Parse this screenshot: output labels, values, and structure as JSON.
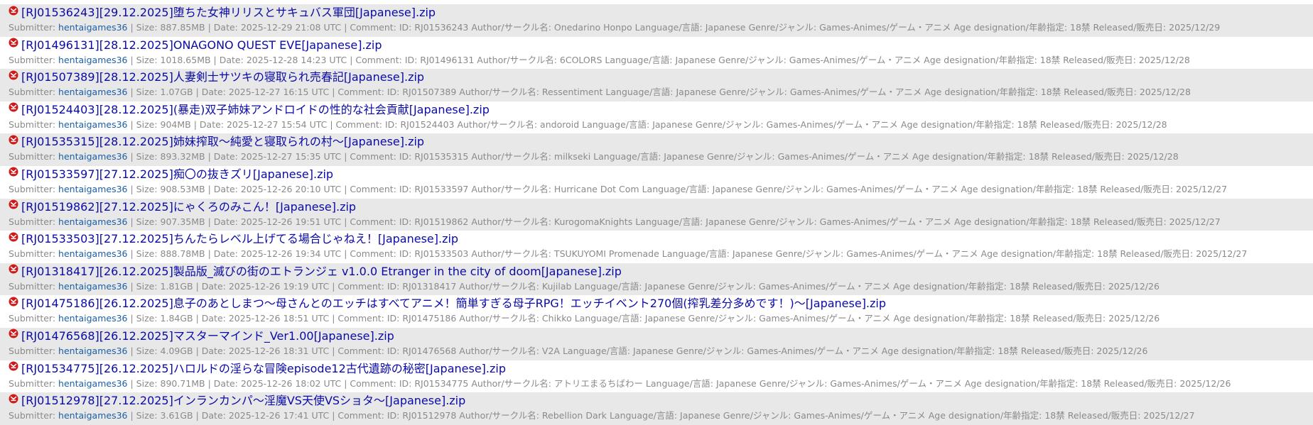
{
  "labels": {
    "submitter": "Submitter: ",
    "size": " | Size: ",
    "date": " | Date: ",
    "comment": " | Comment: "
  },
  "icon_name": "file-badge-icon",
  "items": [
    {
      "title": "[RJ01536243][29.12.2025]堕ちた女神リリスとサキュバス軍団[Japanese].zip",
      "submitter": "hentaigames36",
      "size": "887.85MB",
      "date": "2025-12-29 21:08 UTC",
      "comment": "ID: RJ01536243 Author/サークル名: Onedarino Honpo Language/言語: Japanese Genre/ジャンル: Games-Animes/ゲーム・アニメ Age designation/年齢指定: 18禁 Released/販売日: 2025/12/29"
    },
    {
      "title": "[RJ01496131][28.12.2025]ONAGONO QUEST EVE[Japanese].zip",
      "submitter": "hentaigames36",
      "size": "1018.65MB",
      "date": "2025-12-28 14:23 UTC",
      "comment": "ID: RJ01496131 Author/サークル名: 6COLORS Language/言語: Japanese Genre/ジャンル: Games-Animes/ゲーム・アニメ Age designation/年齢指定: 18禁 Released/販売日: 2025/12/28"
    },
    {
      "title": "[RJ01507389][28.12.2025]人妻剣士サツキの寝取られ売春記[Japanese].zip",
      "submitter": "hentaigames36",
      "size": "1.07GB",
      "date": "2025-12-27 16:15 UTC",
      "comment": "ID: RJ01507389 Author/サークル名: Ressentiment Language/言語: Japanese Genre/ジャンル: Games-Animes/ゲーム・アニメ Age designation/年齢指定: 18禁 Released/販売日: 2025/12/28"
    },
    {
      "title": "[RJ01524403][28.12.2025](暴走)双子姉妹アンドロイドの性的な社会貢献[Japanese].zip",
      "submitter": "hentaigames36",
      "size": "904MB",
      "date": "2025-12-27 15:54 UTC",
      "comment": "ID: RJ01524403 Author/サークル名: andoroid Language/言語: Japanese Genre/ジャンル: Games-Animes/ゲーム・アニメ Age designation/年齢指定: 18禁 Released/販売日: 2025/12/28"
    },
    {
      "title": "[RJ01535315][28.12.2025]姉妹搾取～純愛と寝取られの村～[Japanese].zip",
      "submitter": "hentaigames36",
      "size": "893.32MB",
      "date": "2025-12-27 15:35 UTC",
      "comment": "ID: RJ01535315 Author/サークル名: milkseki Language/言語: Japanese Genre/ジャンル: Games-Animes/ゲーム・アニメ Age designation/年齢指定: 18禁 Released/販売日: 2025/12/28"
    },
    {
      "title": "[RJ01533597][27.12.2025]痴〇の抜きズリ[Japanese].zip",
      "submitter": "hentaigames36",
      "size": "908.53MB",
      "date": "2025-12-26 20:10 UTC",
      "comment": "ID: RJ01533597 Author/サークル名: Hurricane Dot Com Language/言語: Japanese Genre/ジャンル: Games-Animes/ゲーム・アニメ Age designation/年齢指定: 18禁 Released/販売日: 2025/12/27"
    },
    {
      "title": "[RJ01519862][27.12.2025]にゃくろのみこん！[Japanese].zip",
      "submitter": "hentaigames36",
      "size": "907.35MB",
      "date": "2025-12-26 19:51 UTC",
      "comment": "ID: RJ01519862 Author/サークル名: KurogomaKnights Language/言語: Japanese Genre/ジャンル: Games-Animes/ゲーム・アニメ Age designation/年齢指定: 18禁 Released/販売日: 2025/12/27"
    },
    {
      "title": "[RJ01533503][27.12.2025]ちんたらレベル上げてる場合じゃねえ！[Japanese].zip",
      "submitter": "hentaigames36",
      "size": "888.78MB",
      "date": "2025-12-26 19:34 UTC",
      "comment": "ID: RJ01533503 Author/サークル名: TSUKUYOMI Promenade Language/言語: Japanese Genre/ジャンル: Games-Animes/ゲーム・アニメ Age designation/年齢指定: 18禁 Released/販売日: 2025/12/27"
    },
    {
      "title": "[RJ01318417][26.12.2025]製品版_滅びの街のエトランジェ v1.0.0 Etranger in the city of doom[Japanese].zip",
      "submitter": "hentaigames36",
      "size": "1.81GB",
      "date": "2025-12-26 19:19 UTC",
      "comment": "ID: RJ01318417 Author/サークル名: Kujilab Language/言語: Japanese Genre/ジャンル: Games-Animes/ゲーム・アニメ Age designation/年齢指定: 18禁 Released/販売日: 2025/12/26"
    },
    {
      "title": "[RJ01475186][26.12.2025]息子のあとしまつ～母さんとのエッチはすべてアニメ！簡単すぎる母子RPG！エッチイベント270個(搾乳差分多めです！)～[Japanese].zip",
      "submitter": "hentaigames36",
      "size": "1.84GB",
      "date": "2025-12-26 18:51 UTC",
      "comment": "ID: RJ01475186 Author/サークル名: Chikko Language/言語: Japanese Genre/ジャンル: Games-Animes/ゲーム・アニメ Age designation/年齢指定: 18禁 Released/販売日: 2025/12/26"
    },
    {
      "title": "[RJ01476568][26.12.2025]マスターマインド_Ver1.00[Japanese].zip",
      "submitter": "hentaigames36",
      "size": "4.09GB",
      "date": "2025-12-26 18:31 UTC",
      "comment": "ID: RJ01476568 Author/サークル名: V2A Language/言語: Japanese Genre/ジャンル: Games-Animes/ゲーム・アニメ Age designation/年齢指定: 18禁 Released/販売日: 2025/12/26"
    },
    {
      "title": "[RJ01534775][26.12.2025]ハロルドの淫らな冒険episode12古代遺跡の秘密[Japanese].zip",
      "submitter": "hentaigames36",
      "size": "890.71MB",
      "date": "2025-12-26 18:02 UTC",
      "comment": "ID: RJ01534775 Author/サークル名: アトリエまるちばわー Language/言語: Japanese Genre/ジャンル: Games-Animes/ゲーム・アニメ Age designation/年齢指定: 18禁 Released/販売日: 2025/12/26"
    },
    {
      "title": "[RJ01512978][27.12.2025]インランカンパ～淫魔VS天使VSショタ～[Japanese].zip",
      "submitter": "hentaigames36",
      "size": "3.61GB",
      "date": "2025-12-26 17:41 UTC",
      "comment": "ID: RJ01512978 Author/サークル名: Rebellion Dark Language/言語: Japanese Genre/ジャンル: Games-Animes/ゲーム・アニメ Age designation/年齢指定: 18禁 Released/販売日: 2025/12/27"
    }
  ]
}
